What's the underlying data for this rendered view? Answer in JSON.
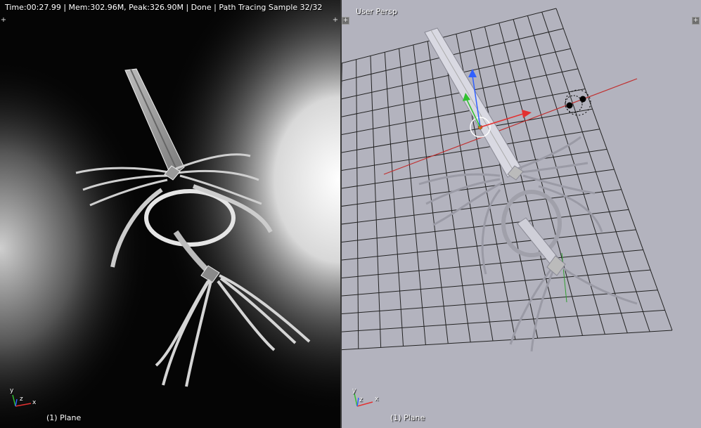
{
  "render_view": {
    "status_text": "Time:00:27.99 | Mem:302.96M, Peak:326.90M | Done | Path Tracing Sample 32/32",
    "object_label": "(1) Plane",
    "bg_color": "#000000"
  },
  "viewport_3d": {
    "view_name": "User Persp",
    "object_label": "(1) Plane",
    "bg_color": "#b3b3be"
  },
  "axis_gizmo": {
    "x_label": "x",
    "y_label": "y",
    "z_label": "z"
  },
  "colors": {
    "x_axis": "#e33030",
    "y_axis": "#30c030",
    "z_axis": "#3060ff"
  },
  "icons": {
    "corner_split": "plus-icon",
    "light": "lamp-icon",
    "origin": "object-origin-icon"
  }
}
